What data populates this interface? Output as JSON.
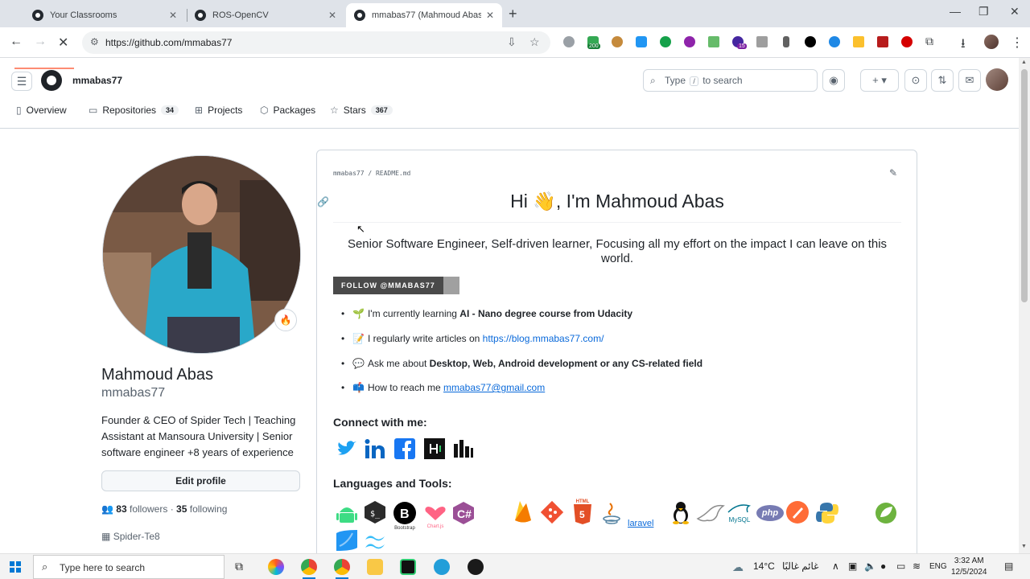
{
  "browser": {
    "tabs": [
      {
        "title": "Your Classrooms"
      },
      {
        "title": "ROS-OpenCV"
      },
      {
        "title": "mmabas77 (Mahmoud Abas)"
      }
    ],
    "url": "https://github.com/mmabas77",
    "extension_badges": {
      "first": "200",
      "second": "15"
    }
  },
  "header": {
    "username": "mmabas77",
    "search": {
      "before": "Type",
      "key": "/",
      "after": "to search"
    }
  },
  "profile_tabs": [
    {
      "label": "Overview",
      "icon": "book-icon"
    },
    {
      "label": "Repositories",
      "icon": "repo-icon",
      "count": "34"
    },
    {
      "label": "Projects",
      "icon": "table-icon"
    },
    {
      "label": "Packages",
      "icon": "package-icon"
    },
    {
      "label": "Stars",
      "icon": "star-icon",
      "count": "367"
    }
  ],
  "profile": {
    "name": "Mahmoud Abas",
    "login": "mmabas77",
    "bio": "Founder & CEO of Spider Tech | Teaching Assistant at Mansoura University | Senior software engineer +8 years of experience",
    "edit_label": "Edit profile",
    "followers_count": "83",
    "followers_label": "followers",
    "separator": "·",
    "following_count": "35",
    "following_label": "following",
    "organization": "Spider-Te8",
    "status_emoji": "🔥"
  },
  "readme": {
    "path": "mmabas77 / README.md",
    "heading_pre": "Hi ",
    "heading_emoji": "👋",
    "heading_post": ", I'm Mahmoud Abas",
    "subtitle": "Senior Software Engineer, Self-driven learner, Focusing all my effort on the impact I can leave on this world.",
    "follow_badge": "FOLLOW @MMABAS77",
    "bullets": [
      {
        "emoji": "🌱",
        "text": "I'm currently learning ",
        "strong": "AI - Nano degree course from Udacity"
      },
      {
        "emoji": "📝",
        "text": "I regularly write articles on ",
        "link": "https://blog.mmabas77.com/"
      },
      {
        "emoji": "💬",
        "text": "Ask me about ",
        "strong": "Desktop, Web, Android development or any CS-related field"
      },
      {
        "emoji": "📫",
        "text": "How to reach me ",
        "link": "mmabas77@gmail.com"
      }
    ],
    "connect_heading": "Connect with me:",
    "languages_heading": "Languages and Tools:",
    "social_icons": [
      "twitter-icon",
      "linkedin-icon",
      "facebook-icon",
      "hackerrank-icon",
      "medium-icon"
    ],
    "tool_labels": {
      "bootstrap": "Bootstrap",
      "chartjs": "Chart.js",
      "html": "HTML",
      "laravel": "laravel",
      "mysql": "MySQL",
      "php": "php"
    }
  },
  "taskbar": {
    "search_placeholder": "Type here to search",
    "weather_temp": "14°C",
    "weather_text": "غائم غالبًا",
    "language": "ENG",
    "time": "3:32 AM",
    "date": "12/5/2024"
  },
  "colors": {
    "accent": "#fd8c73",
    "link": "#0969da",
    "text": "#1f2328",
    "muted": "#59636e"
  }
}
